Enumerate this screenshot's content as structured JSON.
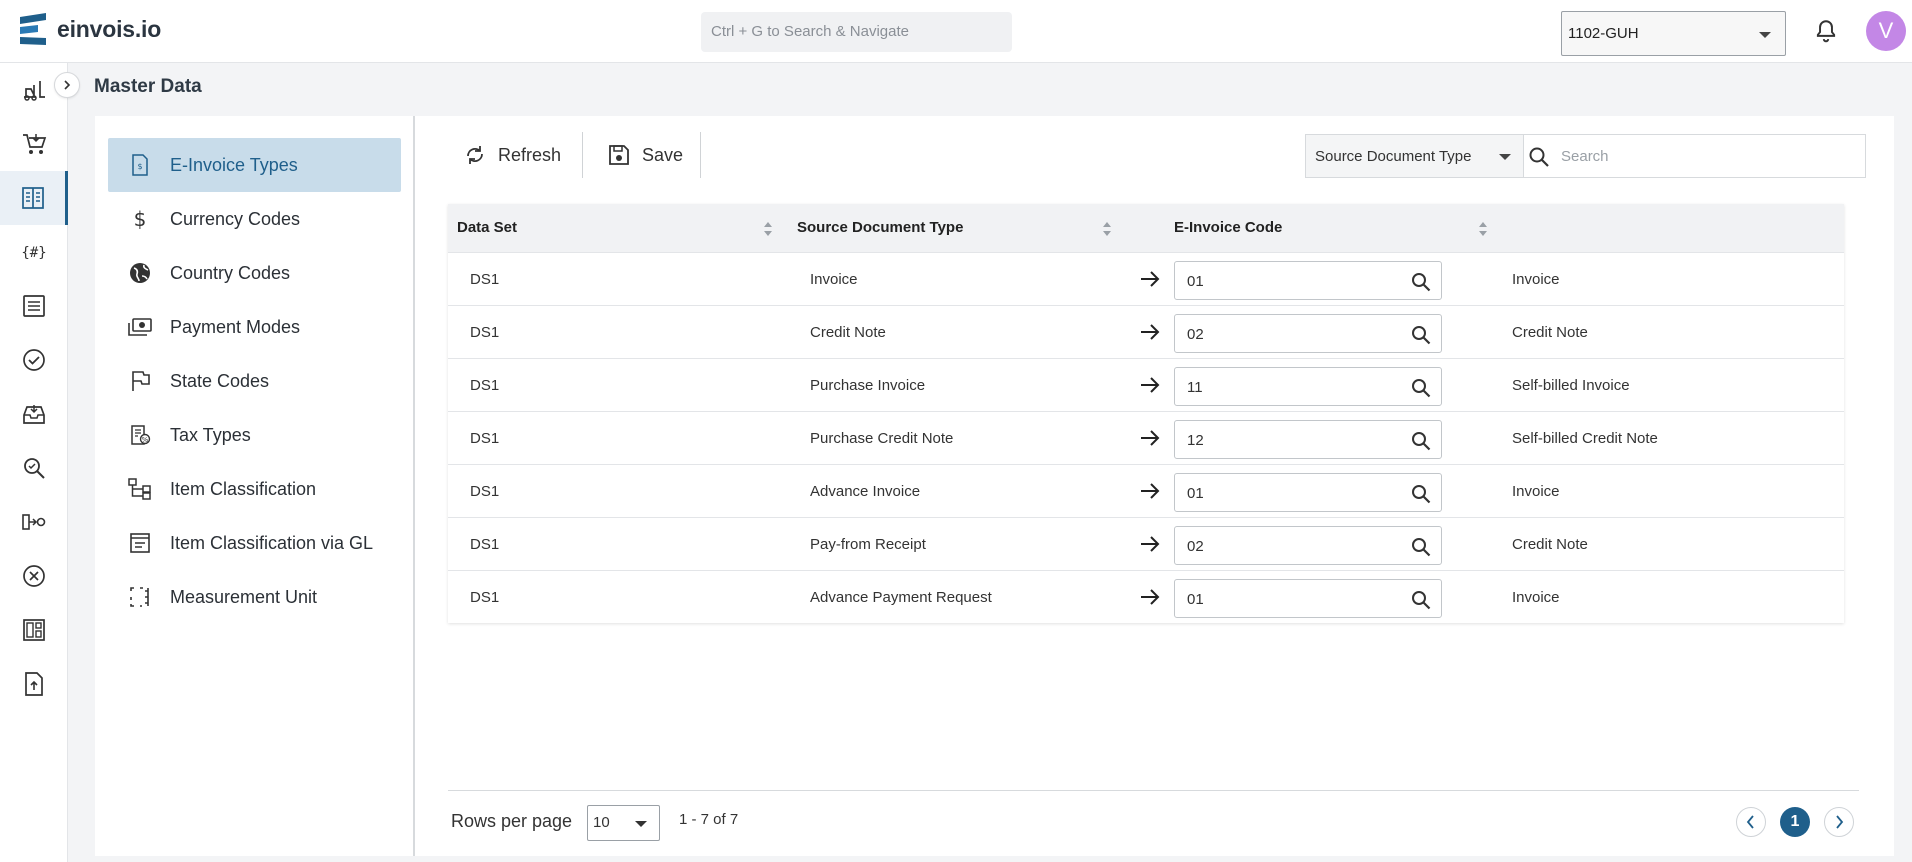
{
  "app": {
    "name": "einvois.io",
    "global_search_placeholder": "Ctrl + G to Search & Navigate",
    "company": "1102-GUH",
    "user_initial": "V",
    "accent": "#1f5f8b"
  },
  "rail": {
    "icons": [
      "forklift-icon",
      "cart-icon",
      "master-data-icon",
      "hash-braces-icon",
      "document-list-icon",
      "check-circle-icon",
      "inbox-icon",
      "search-zoom-icon",
      "flow-icon",
      "cancel-circle-icon",
      "layout-icon",
      "upload-file-icon"
    ],
    "active_index": 2
  },
  "page": {
    "title": "Master Data"
  },
  "subnav": {
    "items": [
      {
        "label": "E-Invoice Types",
        "icon": "invoice-file-icon",
        "active": true
      },
      {
        "label": "Currency Codes",
        "icon": "dollar-icon"
      },
      {
        "label": "Country Codes",
        "icon": "globe-icon"
      },
      {
        "label": "Payment Modes",
        "icon": "cash-icon"
      },
      {
        "label": "State Codes",
        "icon": "flag-icon"
      },
      {
        "label": "Tax Types",
        "icon": "tax-receipt-icon"
      },
      {
        "label": "Item Classification",
        "icon": "hierarchy-icon"
      },
      {
        "label": "Item Classification via GL",
        "icon": "ledger-icon"
      },
      {
        "label": "Measurement Unit",
        "icon": "measure-icon"
      }
    ]
  },
  "toolbar": {
    "refresh_label": "Refresh",
    "save_label": "Save",
    "filter_value": "Source Document Type",
    "search_placeholder": "Search"
  },
  "table": {
    "columns": [
      "Data Set",
      "Source Document Type",
      "E-Invoice Code"
    ],
    "rows": [
      {
        "data_set": "DS1",
        "source": "Invoice",
        "code": "01",
        "description": "Invoice"
      },
      {
        "data_set": "DS1",
        "source": "Credit Note",
        "code": "02",
        "description": "Credit Note"
      },
      {
        "data_set": "DS1",
        "source": "Purchase Invoice",
        "code": "11",
        "description": "Self-billed Invoice"
      },
      {
        "data_set": "DS1",
        "source": "Purchase Credit Note",
        "code": "12",
        "description": "Self-billed Credit Note"
      },
      {
        "data_set": "DS1",
        "source": "Advance Invoice",
        "code": "01",
        "description": "Invoice"
      },
      {
        "data_set": "DS1",
        "source": "Pay-from Receipt",
        "code": "02",
        "description": "Credit Note"
      },
      {
        "data_set": "DS1",
        "source": "Advance Payment Request",
        "code": "01",
        "description": "Invoice"
      }
    ]
  },
  "pagination": {
    "rows_per_page_label": "Rows per page",
    "rows_per_page": "10",
    "range": "1 - 7 of 7",
    "current_page": "1"
  }
}
